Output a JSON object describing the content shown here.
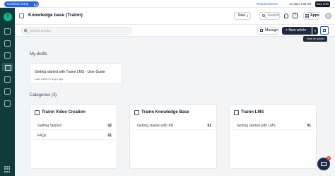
{
  "topbar": {
    "continue_setup": "Continue setup",
    "request_demo": "Request Demo",
    "trial": "10 days trial left",
    "buy_now": "Buy now"
  },
  "header": {
    "title": "Knowledge base (Trainn)",
    "new_label": "New",
    "search_label": "Search",
    "help_label": "?",
    "apps_label": "Apps"
  },
  "toolbar": {
    "search_placeholder": "Search articles",
    "manage_label": "Manage",
    "new_article_label": "New article",
    "portal_tooltip": "View on portal"
  },
  "drafts": {
    "heading": "My drafts",
    "items": [
      {
        "title": "Getting started with Trainn LMS - User Guide",
        "meta": "Last edited 4 days ago"
      }
    ]
  },
  "categories": {
    "heading": "Categories (3)",
    "items": [
      {
        "title": "Trainn Video Creation",
        "rows": [
          {
            "label": "Getting Started",
            "count": "02"
          },
          {
            "label": "FAQs",
            "count": "01"
          }
        ]
      },
      {
        "title": "Trainn Knowledge Base",
        "rows": [
          {
            "label": "Getting started with KB",
            "count": "01"
          }
        ]
      },
      {
        "title": "Trainn LMS",
        "rows": [
          {
            "label": "Getting started with LMS",
            "count": "01"
          }
        ]
      }
    ]
  },
  "chat": {
    "badge": "1"
  },
  "colors": {
    "sidebar": "#0f3b3b",
    "accent": "#2563eb",
    "primary_button": "#1f2a44"
  }
}
